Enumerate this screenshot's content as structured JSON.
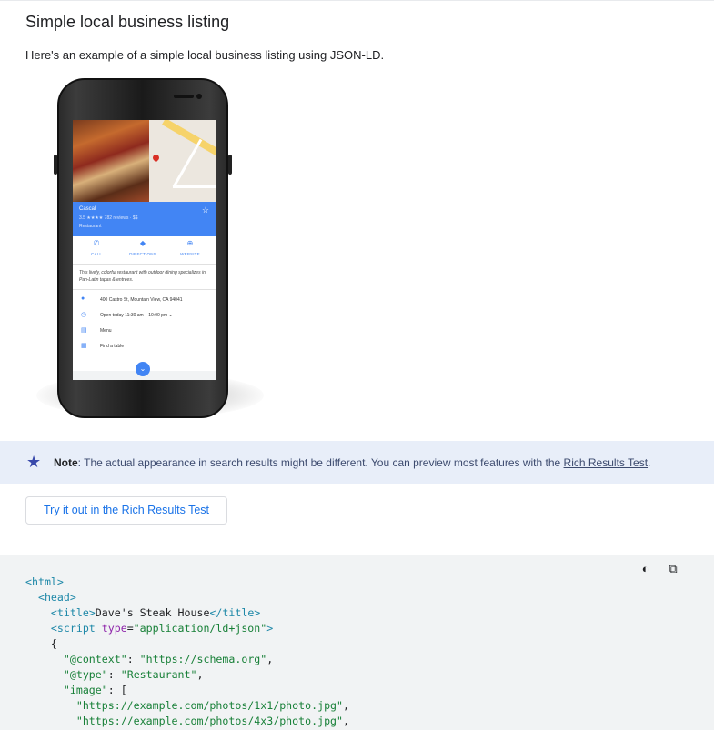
{
  "heading": "Simple local business listing",
  "intro": "Here's an example of a simple local business listing using JSON-LD.",
  "phone": {
    "business_name": "Cascal",
    "rating_line": "3.5 ★★★★ 782 reviews · $$",
    "type": "Restaurant",
    "actions": [
      {
        "icon": "phone-icon",
        "label": "CALL"
      },
      {
        "icon": "directions-icon",
        "label": "DIRECTIONS"
      },
      {
        "icon": "globe-icon",
        "label": "WEBSITE"
      }
    ],
    "description": "This lively, colorful restaurant with outdoor dining specializes in Pan-Latin tapas & entrees.",
    "details": [
      {
        "icon": "location-pin-icon",
        "text": "400 Castro St, Mountain View, CA 94041"
      },
      {
        "icon": "clock-icon",
        "text": "Open today 11:30 am – 10:00 pm ⌄"
      },
      {
        "icon": "menu-book-icon",
        "text": "Menu"
      },
      {
        "icon": "calendar-icon",
        "text": "Find a table"
      }
    ],
    "accent_color": "#4285f4"
  },
  "note": {
    "label": "Note",
    "text": ": The actual appearance in search results might be different. You can preview most features with the ",
    "link": "Rich Results Test",
    "end": "."
  },
  "try_button": "Try it out in the Rich Results Test",
  "code_tools": {
    "theme": "dark-mode-toggle-icon",
    "copy": "copy-icon"
  },
  "code": {
    "l1": "<html>",
    "l2": "<head>",
    "l3_open": "<title>",
    "l3_text": "Dave's Steak House",
    "l3_close": "</title>",
    "l4_open": "<script ",
    "l4_attr": "type",
    "l4_eq": "=",
    "l4_val": "\"application/ld+json\"",
    "l4_close": ">",
    "l5": "{",
    "l6_key": "\"@context\"",
    "l6_val": "\"https://schema.org\"",
    "l7_key": "\"@type\"",
    "l7_val": "\"Restaurant\"",
    "l8_key": "\"image\"",
    "l8_rest": ": [",
    "l9": "\"https://example.com/photos/1x1/photo.jpg\"",
    "l10": "\"https://example.com/photos/4x3/photo.jpg\""
  }
}
